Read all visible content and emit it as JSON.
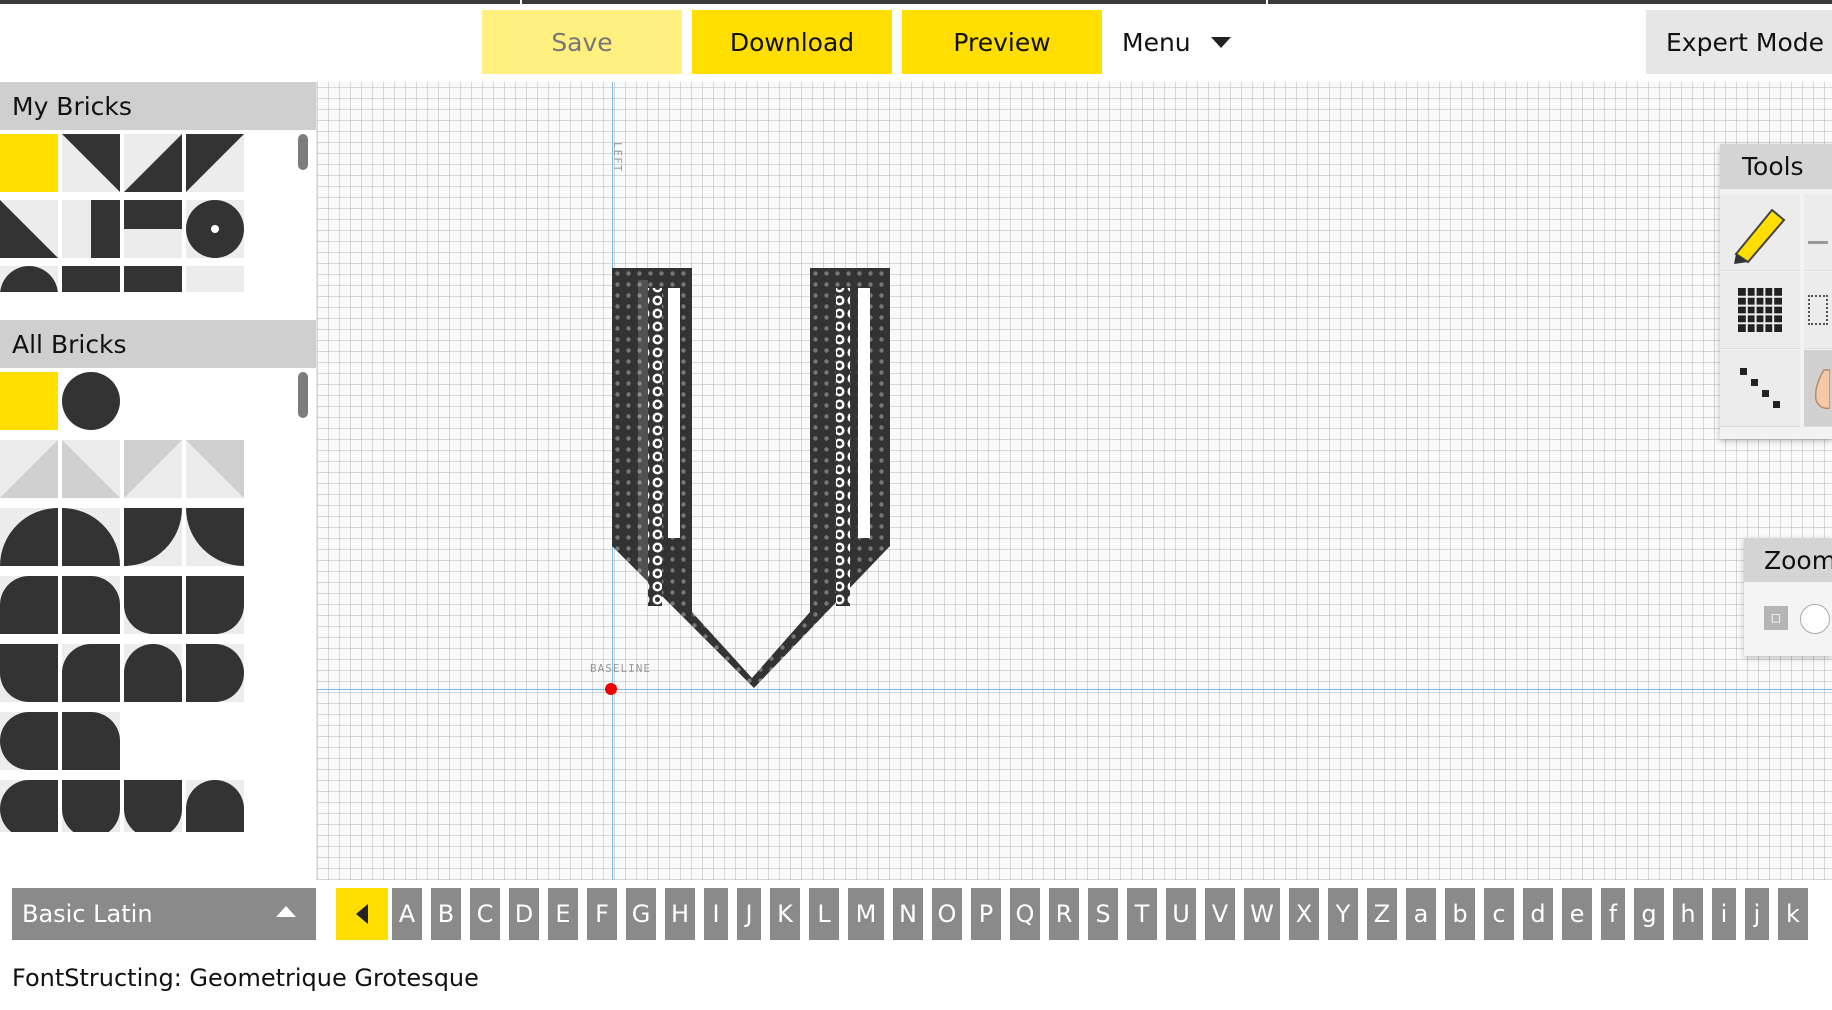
{
  "toolbar": {
    "save_label": "Save",
    "download_label": "Download",
    "preview_label": "Preview",
    "menu_label": "Menu",
    "expert_label": "Expert Mode"
  },
  "sidebar": {
    "my_bricks_title": "My Bricks",
    "all_bricks_title": "All Bricks"
  },
  "canvas": {
    "left_guide_label": "LEFT",
    "baseline_label": "BASELINE"
  },
  "tools": {
    "title": "Tools",
    "zoom_title": "Zoom"
  },
  "charset": {
    "selected": "Basic Latin",
    "characters": [
      "A",
      "B",
      "C",
      "D",
      "E",
      "F",
      "G",
      "H",
      "I",
      "J",
      "K",
      "L",
      "M",
      "N",
      "O",
      "P",
      "Q",
      "R",
      "S",
      "T",
      "U",
      "V",
      "W",
      "X",
      "Y",
      "Z",
      "a",
      "b",
      "c",
      "d",
      "e",
      "f",
      "g",
      "h",
      "i",
      "j",
      "k"
    ]
  },
  "footer": {
    "title": "FontStructing: Geometrique Grotesque"
  },
  "colors": {
    "accent": "#ffde00",
    "accent_disabled": "#fff07f",
    "guide": "#7ab8e6",
    "origin": "#e00000",
    "brick": "#333333"
  }
}
